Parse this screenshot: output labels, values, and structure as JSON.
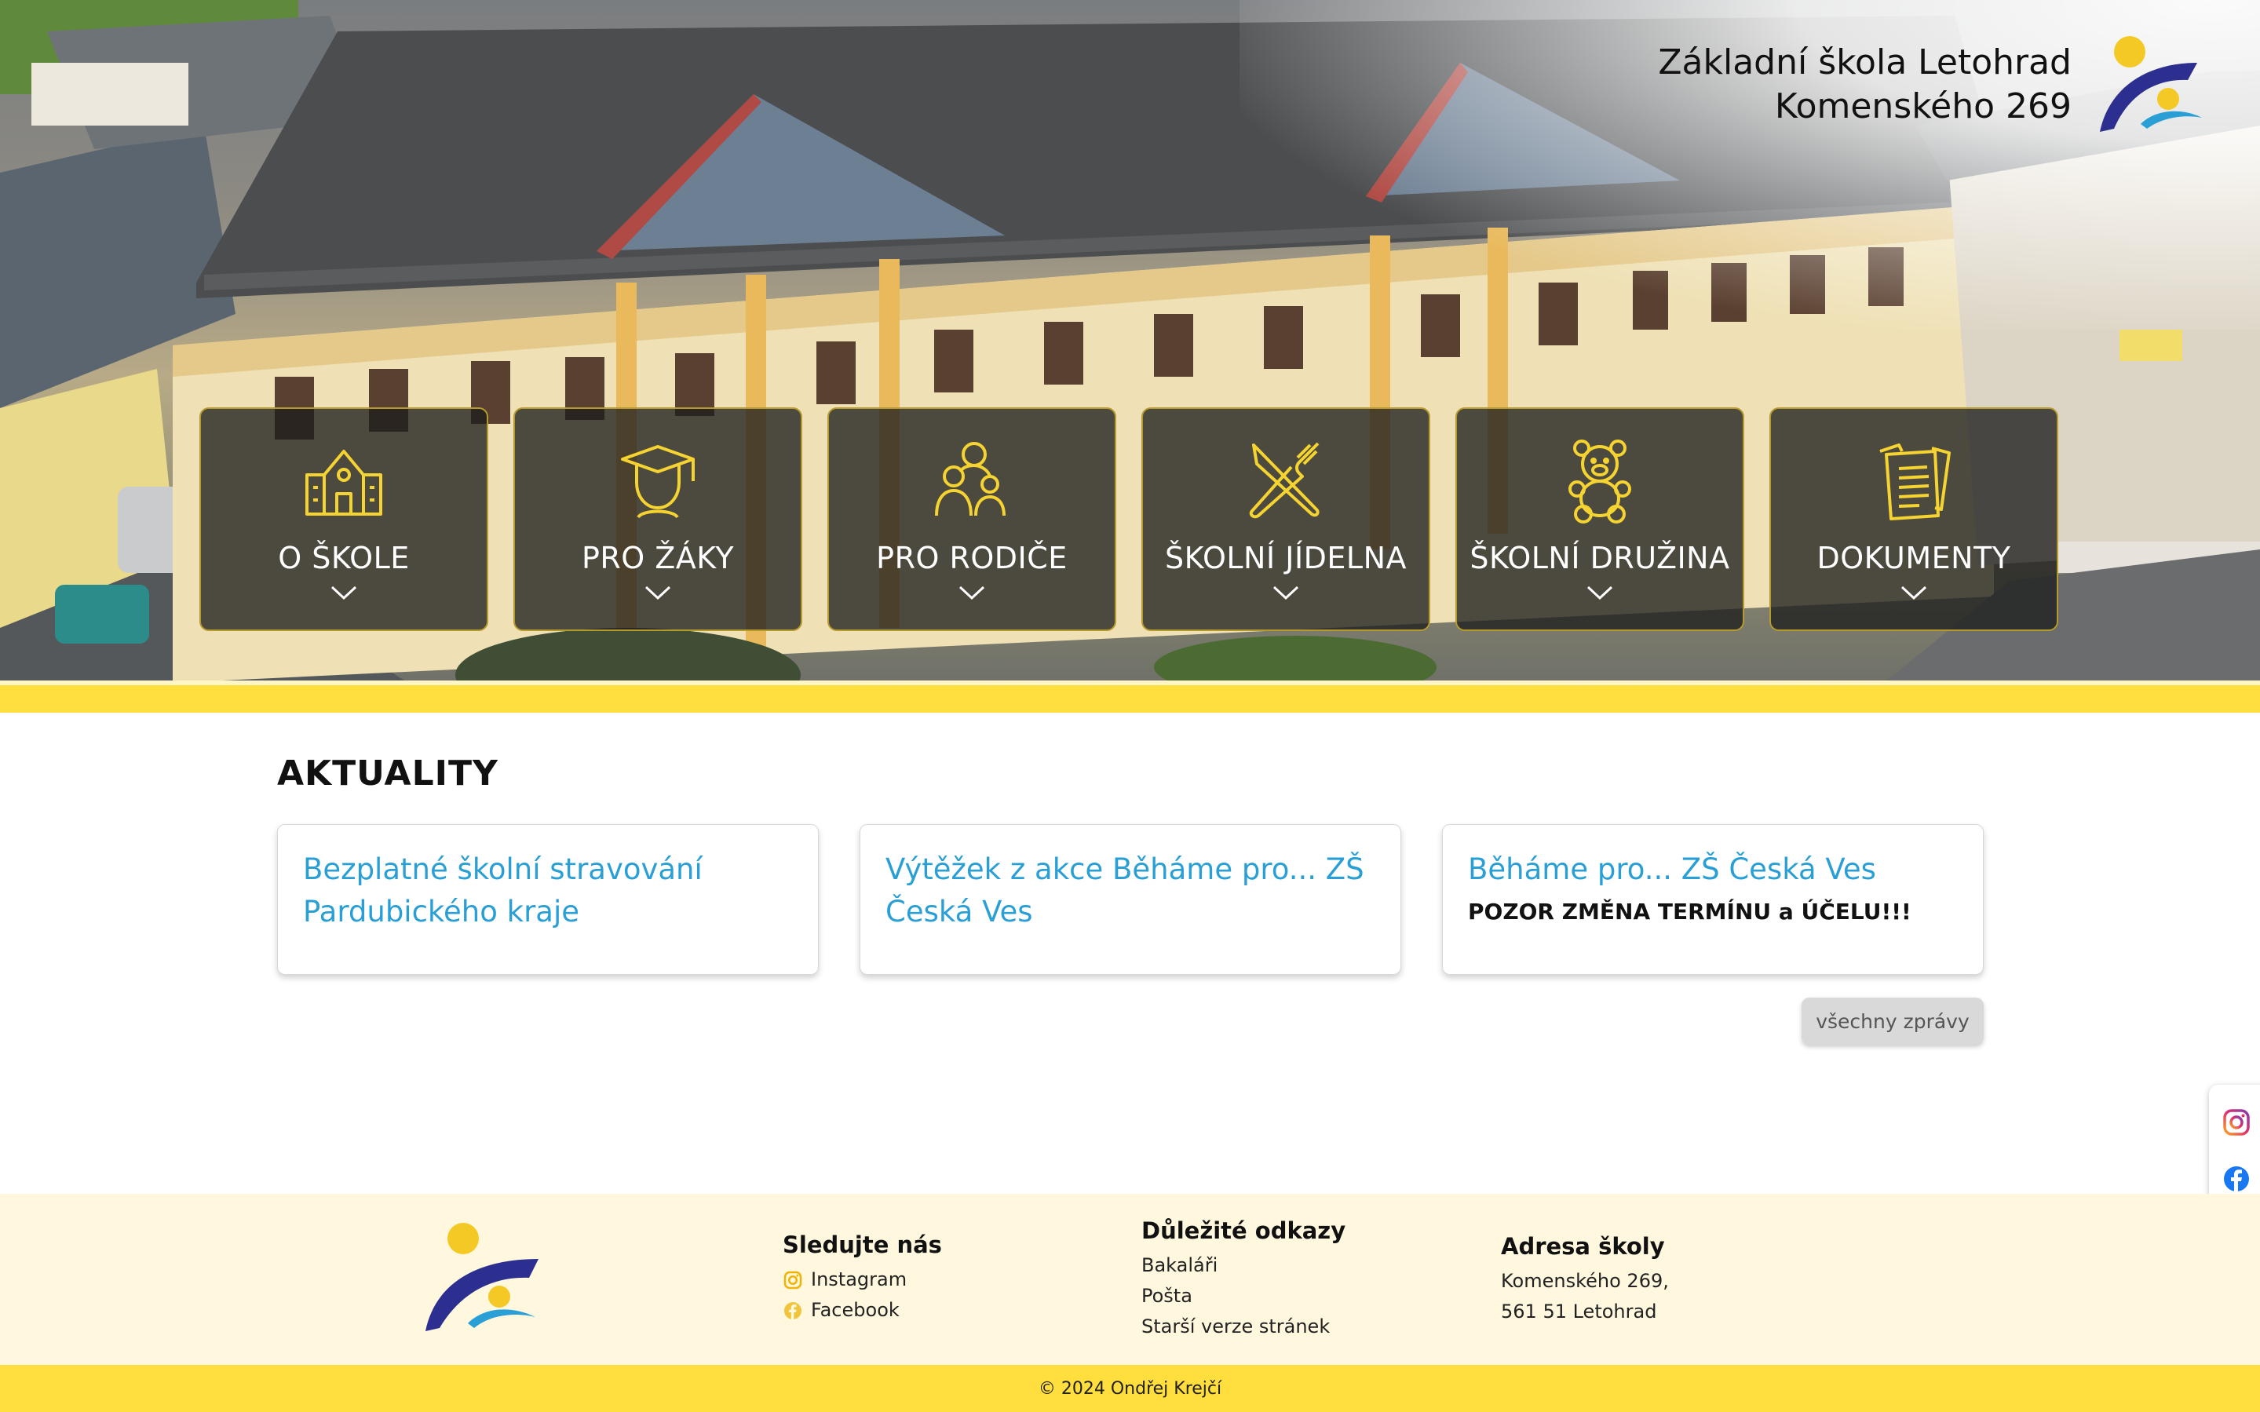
{
  "header": {
    "school_name_line1": "Základní škola Letohrad",
    "school_name_line2": "Komenského 269"
  },
  "nav": {
    "items": [
      {
        "label": "O ŠKOLE",
        "icon": "school-building-icon"
      },
      {
        "label": "PRO ŽÁKY",
        "icon": "graduate-cap-icon"
      },
      {
        "label": "PRO RODIČE",
        "icon": "family-icon"
      },
      {
        "label": "ŠKOLNÍ JÍDELNA",
        "icon": "knife-fork-icon"
      },
      {
        "label": "ŠKOLNÍ DRUŽINA",
        "icon": "teddy-bear-icon"
      },
      {
        "label": "DOKUMENTY",
        "icon": "documents-icon"
      }
    ]
  },
  "news": {
    "heading": "AKTUALITY",
    "cards": [
      {
        "title": "Bezplatné školní stravování Pardubického kraje",
        "subtitle": ""
      },
      {
        "title": "Výtěžek z akce Běháme pro... ZŠ Česká Ves",
        "subtitle": ""
      },
      {
        "title": "Běháme pro... ZŠ Česká Ves",
        "subtitle": "POZOR ZMĚNA TERMÍNU a ÚČELU!!!"
      }
    ],
    "all_news_label": "všechny zprávy"
  },
  "social_sidebar": [
    "instagram-icon",
    "facebook-icon",
    "bakalari-icon",
    "outlook-icon"
  ],
  "footer": {
    "follow": {
      "heading": "Sledujte nás",
      "items": [
        "Instagram",
        "Facebook"
      ]
    },
    "links": {
      "heading": "Důležité odkazy",
      "items": [
        "Bakaláři",
        "Pošta",
        "Starší verze stránek"
      ]
    },
    "address": {
      "heading": "Adresa školy",
      "line1": "Komenského 269,",
      "line2": "561 51 Letohrad"
    },
    "copyright": "© 2024 Ondřej Krejčí"
  },
  "colors": {
    "accent_yellow": "#ffde3d",
    "icon_yellow": "#f5d331",
    "link_blue": "#2a9fd6",
    "logo_navy": "#2c2f8f",
    "footer_bg": "#fff8df"
  }
}
